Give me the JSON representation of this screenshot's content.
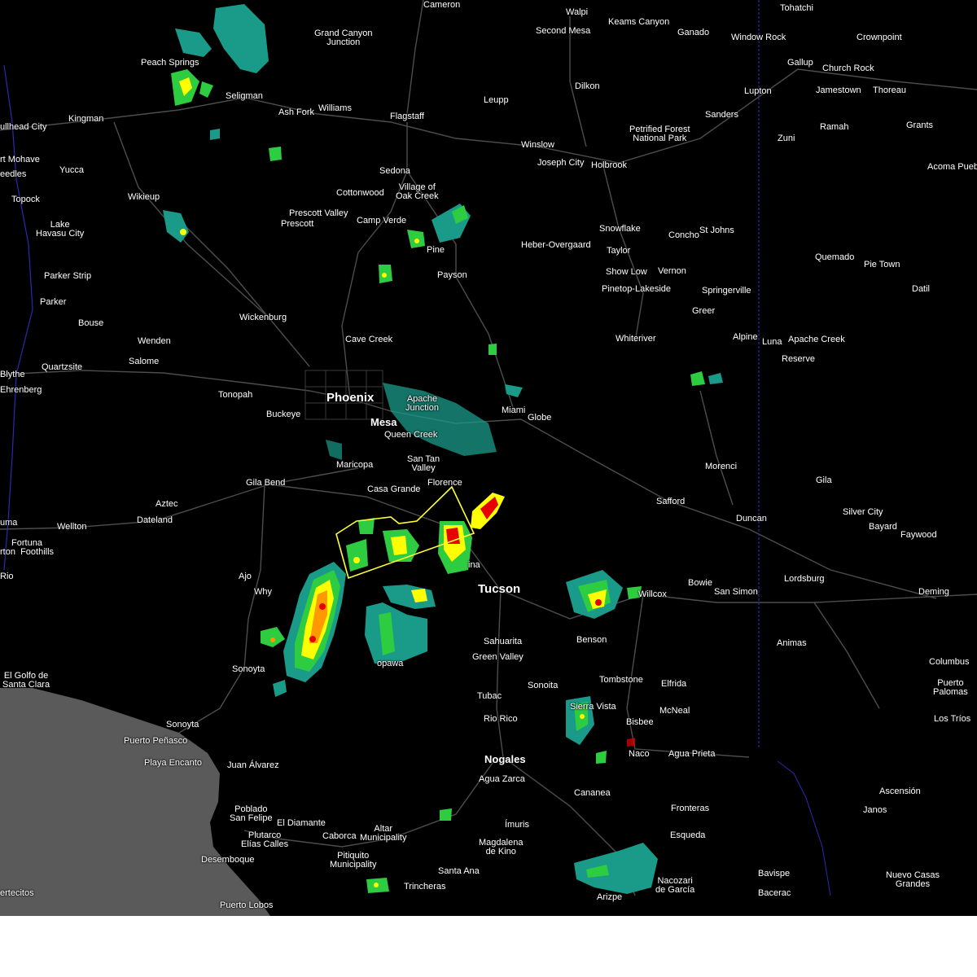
{
  "map": {
    "type": "weather radar overlay",
    "colors": {
      "background": "#000000",
      "ocean": "#5a5a5a",
      "roads": "#4d4d4d",
      "state_border": "#2a2ab0",
      "warning_polygon": "#ffff33",
      "radar_light": "#1a9b8a",
      "radar_green": "#2ecc40",
      "radar_yellow": "#ffff00",
      "radar_orange": "#ff9900",
      "radar_red": "#e60000"
    },
    "cities": {
      "cameron": "Cameron",
      "walpi": "Walpi",
      "keams_canyon": "Keams Canyon",
      "second_mesa": "Second Mesa",
      "ganado": "Ganado",
      "window_rock": "Window Rock",
      "tohatchi": "Tohatchi",
      "crownpoint": "Crownpoint",
      "grand_canyon_junction": "Grand Canyon\nJunction",
      "peach_springs": "Peach Springs",
      "gallup": "Gallup",
      "church_rock": "Church Rock",
      "jamestown": "Jamestown",
      "thoreau": "Thoreau",
      "dilkon": "Dilkon",
      "lupton": "Lupton",
      "seligman": "Seligman",
      "bullhead_city": "ullhead City",
      "kingman": "Kingman",
      "ash_fork": "Ash Fork",
      "williams": "Williams",
      "flagstaff": "Flagstaff",
      "leupp": "Leupp",
      "sanders": "Sanders",
      "ramah": "Ramah",
      "grants": "Grants",
      "fort_mohave": "rt Mohave",
      "petrified_forest": "Petrified Forest\nNational Park",
      "zuni": "Zuni",
      "needles": "eedles",
      "winslow": "Winslow",
      "yucca": "Yucca",
      "joseph_city": "Joseph City",
      "holbrook": "Holbrook",
      "acoma_pueblo": "Acoma Pueb",
      "sedona": "Sedona",
      "topock": "Topock",
      "wikieup": "Wikieup",
      "village_of_oak_creek": "Village of\nOak Creek",
      "cottonwood": "Cottonwood",
      "prescott_valley": "Prescott Valley",
      "camp_verde": "Camp Verde",
      "lake_havasu_city": "Lake\nHavasu City",
      "prescott": "Prescott",
      "snowflake": "Snowflake",
      "concho": "Concho",
      "st_johns": "St Johns",
      "heber_overgaard": "Heber-Overgaard",
      "taylor": "Taylor",
      "pine": "Pine",
      "quemado": "Quemado",
      "pie_town": "Pie Town",
      "show_low": "Show Low",
      "vernon": "Vernon",
      "payson": "Payson",
      "parker_strip": "Parker Strip",
      "pinetop_lakeside": "Pinetop-Lakeside",
      "springerville": "Springerville",
      "datil": "Datil",
      "parker": "Parker",
      "greer": "Greer",
      "wickenburg": "Wickenburg",
      "bouse": "Bouse",
      "whiteriver": "Whiteriver",
      "alpine": "Alpine",
      "luna": "Luna",
      "apache_creek": "Apache Creek",
      "cave_creek": "Cave Creek",
      "wenden": "Wenden",
      "reserve": "Reserve",
      "salome": "Salome",
      "quartzsite": "Quartzsite",
      "blythe": "Blythe",
      "ehrenberg": "Ehrenberg",
      "tonopah": "Tonopah",
      "phoenix": "Phoenix",
      "apache_junction": "Apache\nJunction",
      "miami": "Miami",
      "buckeye": "Buckeye",
      "globe": "Globe",
      "mesa": "Mesa",
      "queen_creek": "Queen Creek",
      "san_tan_valley": "San Tan\nValley",
      "maricopa": "Maricopa",
      "morenci": "Morenci",
      "gila_bend": "Gila Bend",
      "florence": "Florence",
      "casa_grande": "Casa Grande",
      "gila": "Gila",
      "aztec": "Aztec",
      "safford": "Safford",
      "dateland": "Dateland",
      "silver_city": "Silver City",
      "duncan": "Duncan",
      "yuma": "uma",
      "wellton": "Wellton",
      "bayard": "Bayard",
      "fortuna_foothills": "Fortuna\nrton  Foothills",
      "faywood": "Faywood",
      "marana": "ina",
      "rio": "Rio",
      "ajo": "Ajo",
      "lordsburg": "Lordsburg",
      "bowie": "Bowie",
      "san_simon": "San Simon",
      "tucson": "Tucson",
      "willcox": "Willcox",
      "deming": "Deming",
      "why": "Why",
      "sahuarita": "Sahuarita",
      "benson": "Benson",
      "animas": "Animas",
      "green_valley": "Green Valley",
      "topawa": "opawa",
      "columbus": "Columbus",
      "el_golfo": "El Golfo de\nSanta Clara",
      "sonoyta": "Sonoyta",
      "tombstone": "Tombstone",
      "elfrida": "Elfrida",
      "puerto_palomas": "Puerto\nPalomas",
      "sonoita": "Sonoita",
      "tubac": "Tubac",
      "sierra_vista": "Sierra Vista",
      "mcneal": "McNeal",
      "los_trios": "Los Tríos",
      "rio_rico": "Rio Rico",
      "bisbee": "Bisbee",
      "sonoyta2": "Sonoyta",
      "puerto_penasco": "Puerto Peñasco",
      "playa_encanto": "Playa Encanto",
      "naco": "Naco",
      "agua_prieta": "Agua Prieta",
      "nogales": "Nogales",
      "juan_alvarez": "Juan Álvarez",
      "agua_zarca": "Agua Zarca",
      "ascension": "Ascensión",
      "cananea": "Cananea",
      "janos": "Janos",
      "poblado_san_felipe": "Poblado\nSan Felipe",
      "el_diamante": "El Diamante",
      "fronteras": "Fronteras",
      "altar_municipality": "Altar\nMunicipality",
      "imuris": "Ímuris",
      "plutarco_elias_calles": "Plutarco\nElías Calles",
      "caborca": "Caborca",
      "esqueda": "Esqueda",
      "magdalena_de_kino": "Magdalena\nde Kino",
      "desemboque": "Desemboque",
      "pitiquito": "Pitiquito\nMunicipality",
      "bavispe": "Bavispe",
      "nuevo_casas_grandes": "Nuevo Casas\nGrandes",
      "santa_ana": "Santa Ana",
      "nacozari": "Nacozari\nde García",
      "trincheras": "Trincheras",
      "arizpe": "Arizpe",
      "bacerac": "Bacerac",
      "puerto_lobos": "Puerto Lobos",
      "ertecitos": "ertecitos"
    }
  }
}
